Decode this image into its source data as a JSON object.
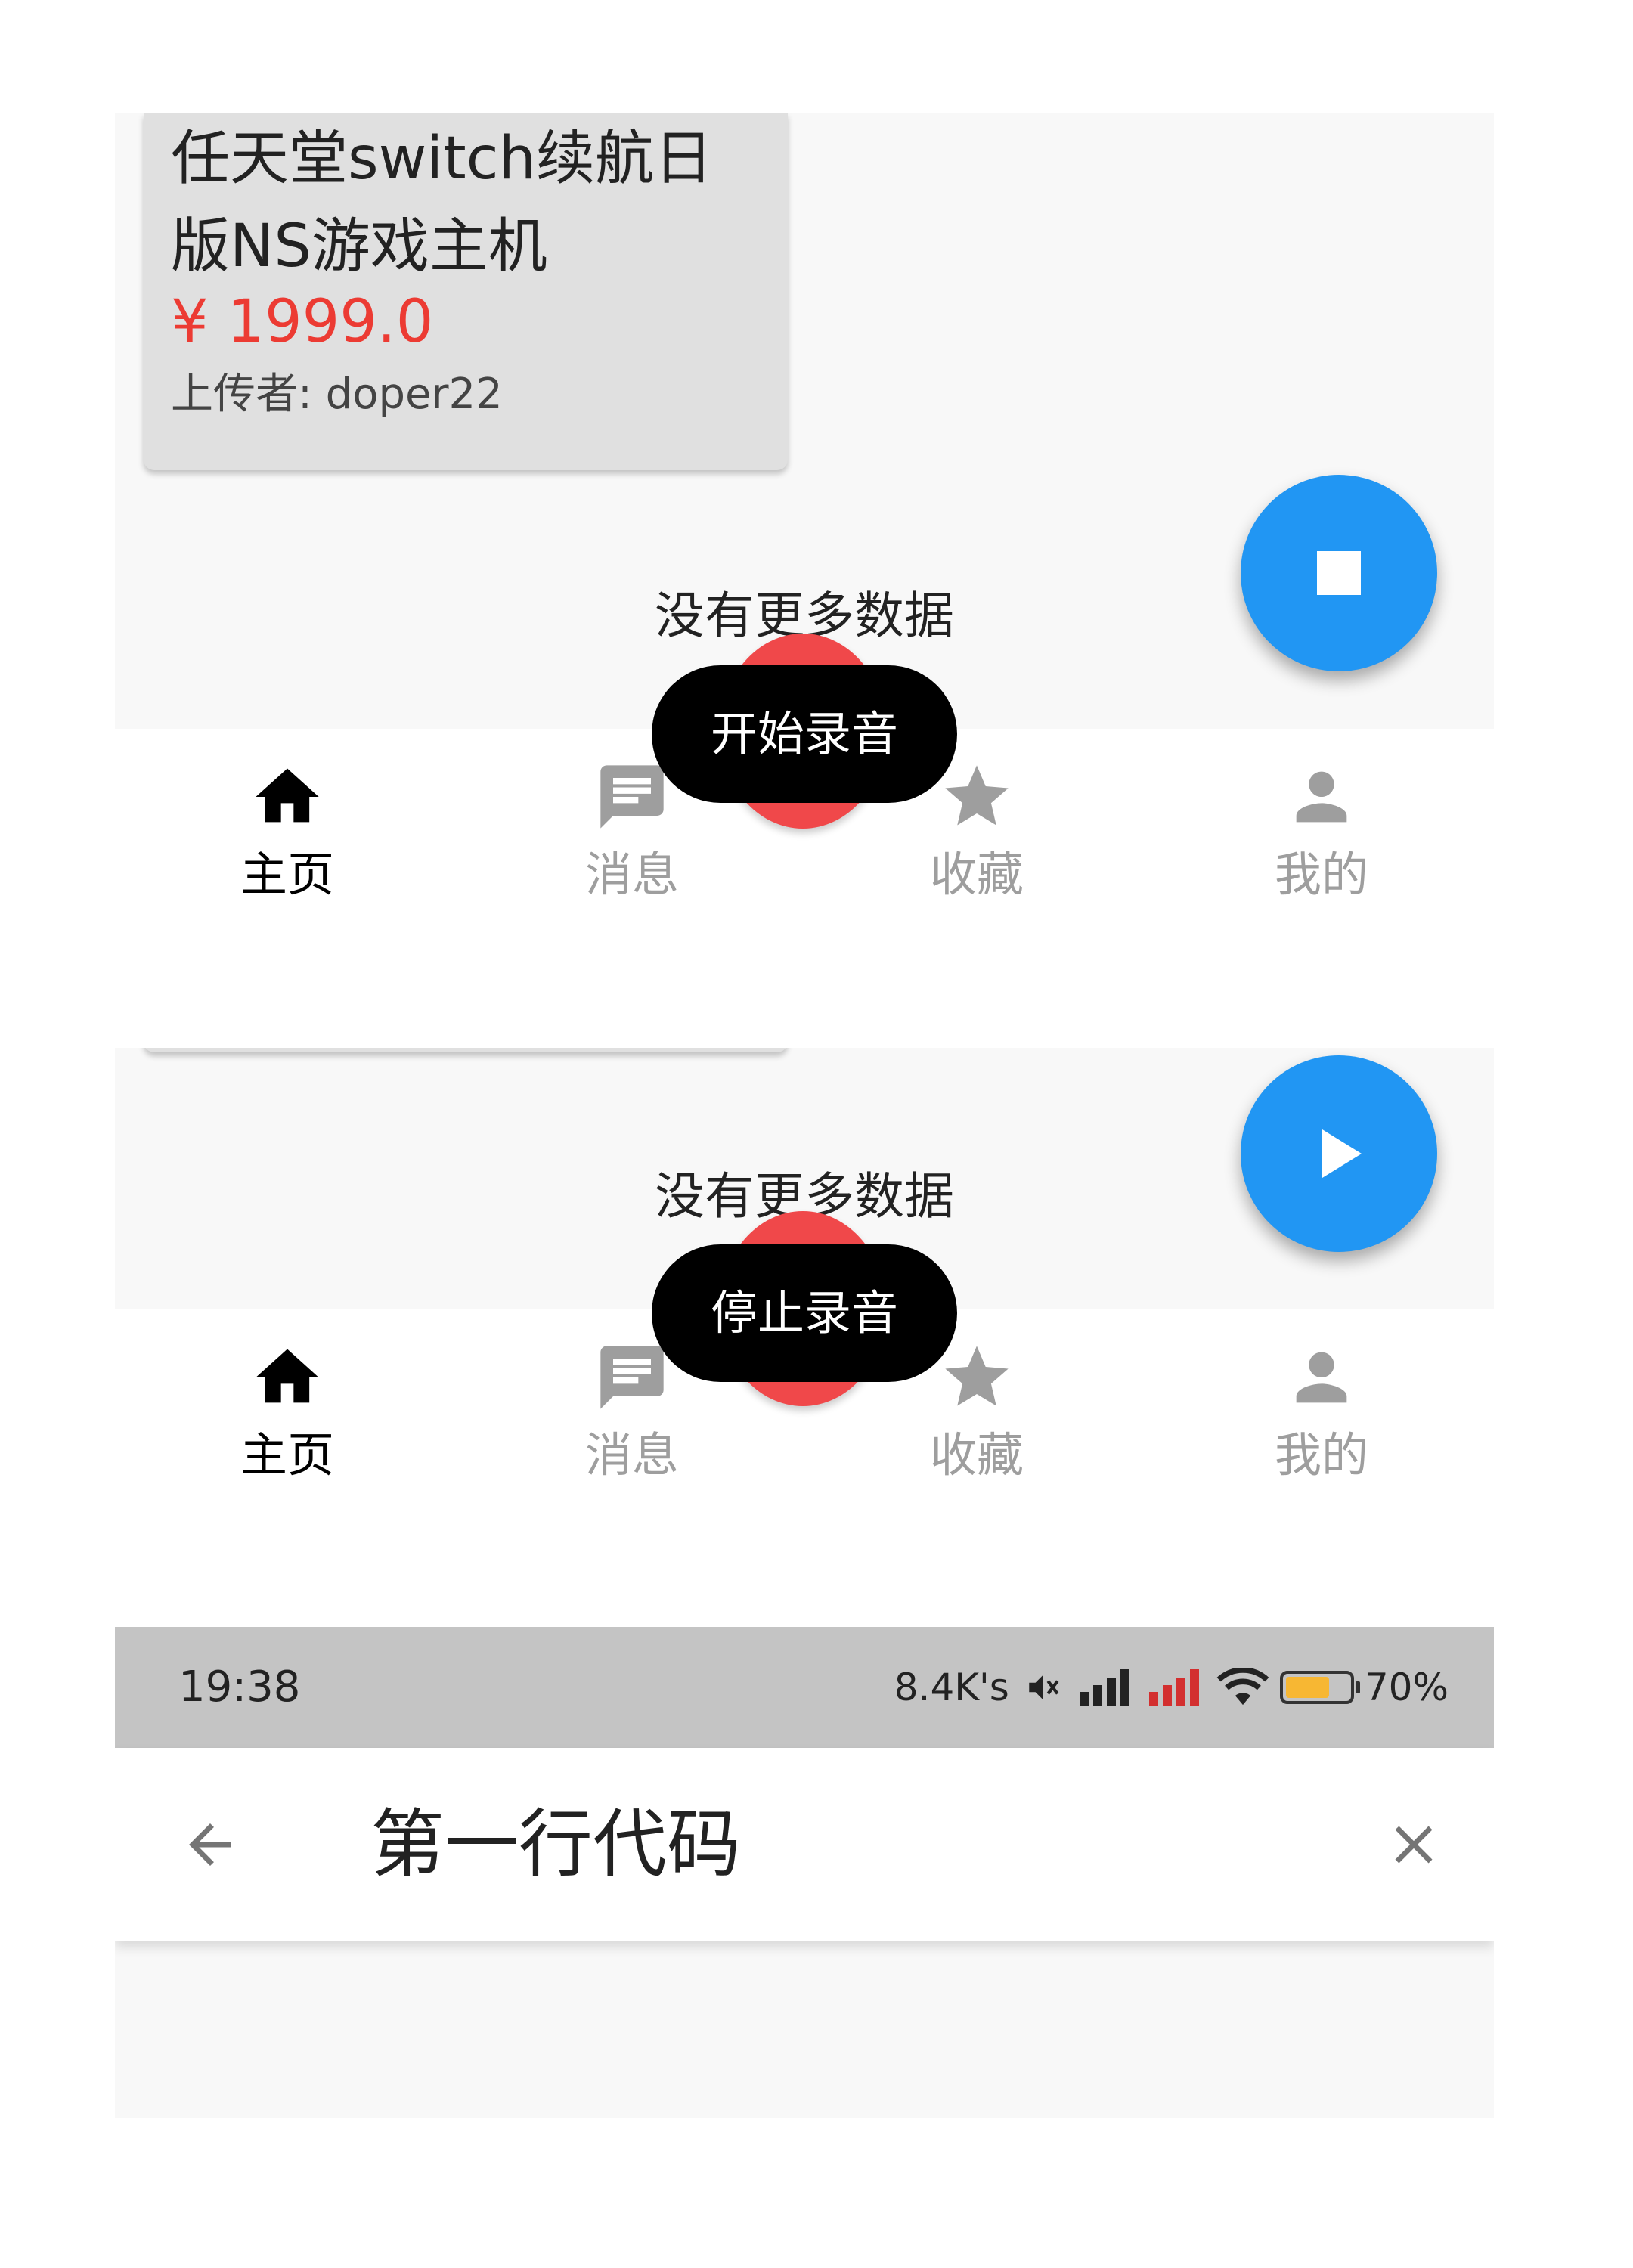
{
  "top_panel": {
    "product": {
      "title_line1": "任天堂switch续航日",
      "title_line2": "版NS游戏主机",
      "price": "¥ 1999.0",
      "uploader": "上传者: doper22"
    },
    "no_more_text": "没有更多数据",
    "toast_text": "开始录音",
    "fab_icon": "stop-icon"
  },
  "middle_panel": {
    "no_more_text": "没有更多数据",
    "toast_text": "停止录音",
    "fab_icon": "play-icon"
  },
  "bottom_nav": {
    "items": [
      {
        "label": "主页",
        "icon": "home-icon",
        "active": true
      },
      {
        "label": "消息",
        "icon": "message-icon",
        "active": false
      },
      {
        "label": "收藏",
        "icon": "star-icon",
        "active": false
      },
      {
        "label": "我的",
        "icon": "person-icon",
        "active": false
      }
    ]
  },
  "bottom_panel": {
    "status_bar": {
      "time": "19:38",
      "network_speed": "8.4K's",
      "battery": "70%",
      "battery_level": 0.7
    },
    "toolbar": {
      "title": "第一行代码",
      "back_icon": "arrow-back-icon",
      "close_icon": "close-icon"
    }
  },
  "colors": {
    "fab": "#2196f3",
    "price": "#ec3b33",
    "record_dot": "#f0484a",
    "battery": "#f7b733",
    "inactive": "#9e9e9e"
  }
}
